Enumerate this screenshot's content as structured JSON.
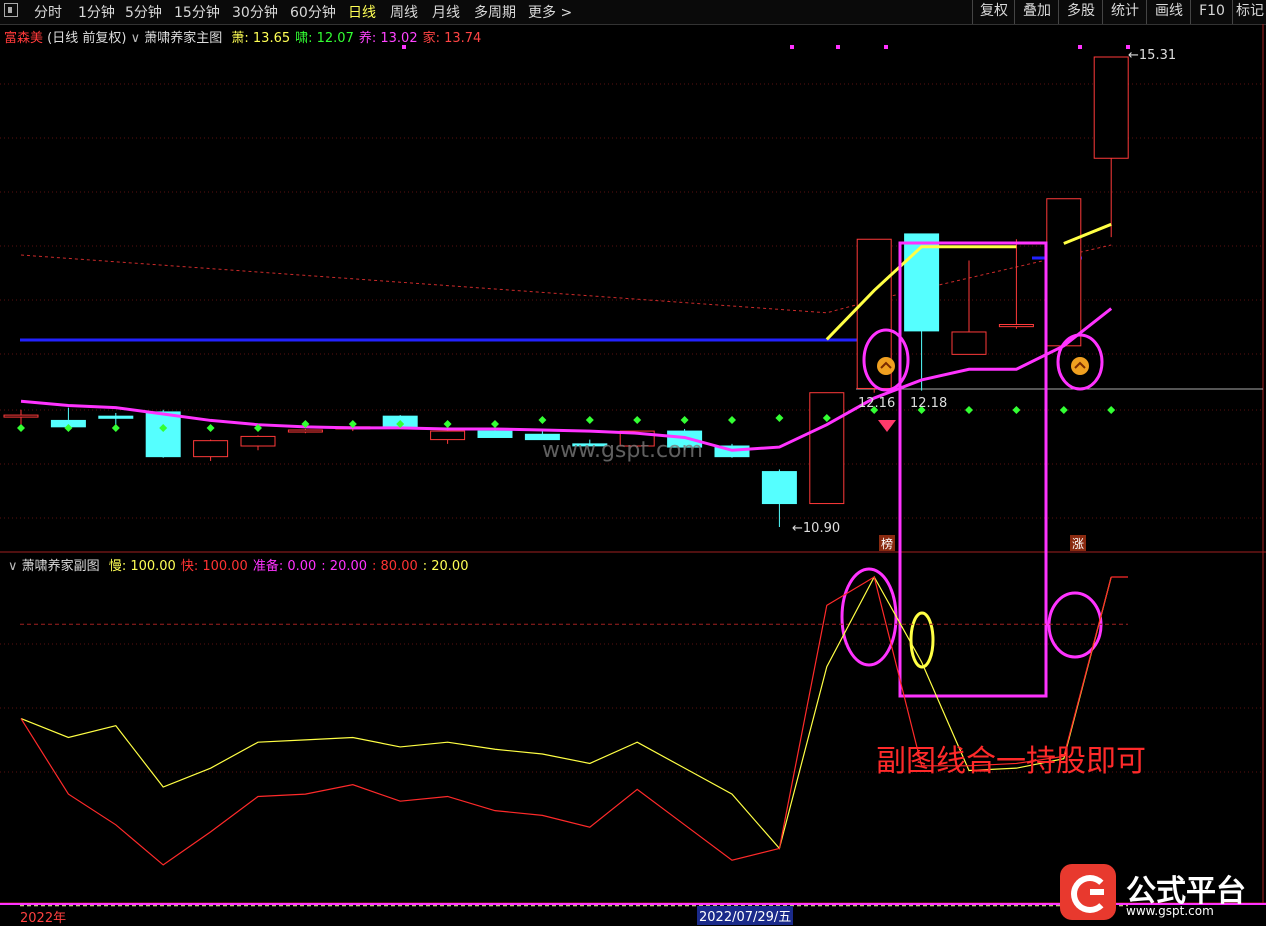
{
  "toolbar": {
    "periods": [
      "分时",
      "1分钟",
      "5分钟",
      "15分钟",
      "30分钟",
      "60分钟",
      "日线",
      "周线",
      "月线",
      "多周期",
      "更多 >"
    ],
    "active": "日线",
    "right_buttons": [
      "复权",
      "叠加",
      "多股",
      "统计",
      "画线",
      "F10",
      "标记"
    ]
  },
  "main_header": {
    "stock": "富森美",
    "mode": "(日线 前复权)",
    "indicator": "萧啸养家主图",
    "values": [
      {
        "label": "萧:",
        "value": "13.65",
        "color": "#ffff55"
      },
      {
        "label": "啸:",
        "value": "12.07",
        "color": "#33ff33"
      },
      {
        "label": "养:",
        "value": "13.02",
        "color": "#ff44ff"
      },
      {
        "label": "家:",
        "value": "13.74",
        "color": "#ff4444"
      }
    ]
  },
  "sub_header": {
    "indicator": "萧啸养家副图",
    "values": [
      {
        "label": "慢:",
        "value": "100.00",
        "color": "#ffff55"
      },
      {
        "label": "快:",
        "value": "100.00",
        "color": "#ff3333"
      },
      {
        "label": "准备:",
        "value": "0.00",
        "color": "#ff33ff"
      },
      {
        "label": ":",
        "value": "20.00",
        "color": "#ff33ff"
      },
      {
        "label": ":",
        "value": "80.00",
        "color": "#ff3333"
      },
      {
        "label": ":",
        "value": "20.00",
        "color": "#ffff55"
      }
    ]
  },
  "price_labels": {
    "high": "15.31",
    "low": "10.90",
    "mid1": "12.16",
    "mid2": "12.18"
  },
  "markers": {
    "bang": "榜",
    "zhang": "涨"
  },
  "watermark": "www.gspt.com",
  "annotation": "副图线合一持股即可",
  "logo": {
    "name": "公式平台",
    "url": "www.gspt.com"
  },
  "dates": {
    "left": "2022年",
    "cursor": "2022/07/29/五"
  },
  "colors": {
    "up": "#ff3a3a",
    "down": "#55ffff",
    "ma_magenta": "#ff33ff",
    "ma_blue": "#2222ff",
    "yellow": "#ffff44",
    "signal_green": "#33ff33",
    "annotation": "#ff33ff"
  },
  "chart_data": {
    "type": "candlestick",
    "candles": [
      {
        "o": 11.95,
        "h": 12.0,
        "l": 11.82,
        "c": 11.95
      },
      {
        "o": 11.9,
        "h": 12.02,
        "l": 11.81,
        "c": 11.84
      },
      {
        "o": 11.94,
        "h": 11.97,
        "l": 11.85,
        "c": 11.92
      },
      {
        "o": 11.98,
        "h": 12.0,
        "l": 11.55,
        "c": 11.56
      },
      {
        "o": 11.56,
        "h": 11.72,
        "l": 11.52,
        "c": 11.71
      },
      {
        "o": 11.66,
        "h": 11.76,
        "l": 11.62,
        "c": 11.75
      },
      {
        "o": 11.8,
        "h": 11.82,
        "l": 11.78,
        "c": 11.81
      },
      {
        "o": 11.82,
        "h": 11.86,
        "l": 11.8,
        "c": 11.84
      },
      {
        "o": 11.94,
        "h": 11.95,
        "l": 11.82,
        "c": 11.84
      },
      {
        "o": 11.72,
        "h": 11.84,
        "l": 11.68,
        "c": 11.8
      },
      {
        "o": 11.8,
        "h": 11.84,
        "l": 11.76,
        "c": 11.74
      },
      {
        "o": 11.77,
        "h": 11.82,
        "l": 11.72,
        "c": 11.72
      },
      {
        "o": 11.68,
        "h": 11.72,
        "l": 11.67,
        "c": 11.67
      },
      {
        "o": 11.66,
        "h": 11.8,
        "l": 11.65,
        "c": 11.8
      },
      {
        "o": 11.8,
        "h": 11.82,
        "l": 11.62,
        "c": 11.65
      },
      {
        "o": 11.66,
        "h": 11.68,
        "l": 11.55,
        "c": 11.56
      },
      {
        "o": 11.42,
        "h": 11.44,
        "l": 10.9,
        "c": 11.12
      },
      {
        "o": 11.12,
        "h": 12.16,
        "l": 11.12,
        "c": 12.16
      },
      {
        "o": 12.2,
        "h": 13.6,
        "l": 12.16,
        "c": 13.6
      },
      {
        "o": 13.65,
        "h": 13.65,
        "l": 12.18,
        "c": 12.74
      },
      {
        "o": 12.52,
        "h": 13.4,
        "l": 12.52,
        "c": 12.73
      },
      {
        "o": 12.78,
        "h": 13.6,
        "l": 12.76,
        "c": 12.8
      },
      {
        "o": 12.6,
        "h": 13.96,
        "l": 12.6,
        "c": 13.98
      },
      {
        "o": 14.36,
        "h": 15.31,
        "l": 13.62,
        "c": 15.31
      }
    ],
    "ma_magenta": [
      12.08,
      12.04,
      12.02,
      11.96,
      11.9,
      11.86,
      11.84,
      11.83,
      11.83,
      11.82,
      11.82,
      11.81,
      11.8,
      11.78,
      11.74,
      11.62,
      11.65,
      11.86,
      12.11,
      12.28,
      12.38,
      12.38,
      12.6,
      12.95
    ],
    "ma_yellow": [
      null,
      null,
      null,
      null,
      null,
      null,
      null,
      null,
      null,
      null,
      null,
      null,
      null,
      null,
      null,
      null,
      null,
      12.66,
      13.12,
      13.53,
      13.53,
      13.53,
      13.56,
      13.74
    ],
    "sub_slow": [
      40.0,
      32.0,
      37.0,
      11.0,
      19.0,
      30.0,
      31.0,
      32.0,
      28.0,
      30.0,
      27.0,
      25.0,
      21.0,
      30.0,
      19.0,
      8.0,
      -15.0,
      62.0,
      100.0,
      64.0,
      18.0,
      19.0,
      23.0,
      100.0
    ],
    "sub_fast": [
      40.0,
      8.0,
      -5.0,
      -22.0,
      -8.0,
      7.0,
      8.0,
      12.0,
      5.0,
      7.0,
      1.0,
      -1.0,
      -6.0,
      10.0,
      -5.0,
      -20.0,
      -15.0,
      88.0,
      100.0,
      20.0,
      20.0,
      21.0,
      24.0,
      100.0
    ],
    "sub_levels": [
      80.0,
      20.0
    ]
  }
}
